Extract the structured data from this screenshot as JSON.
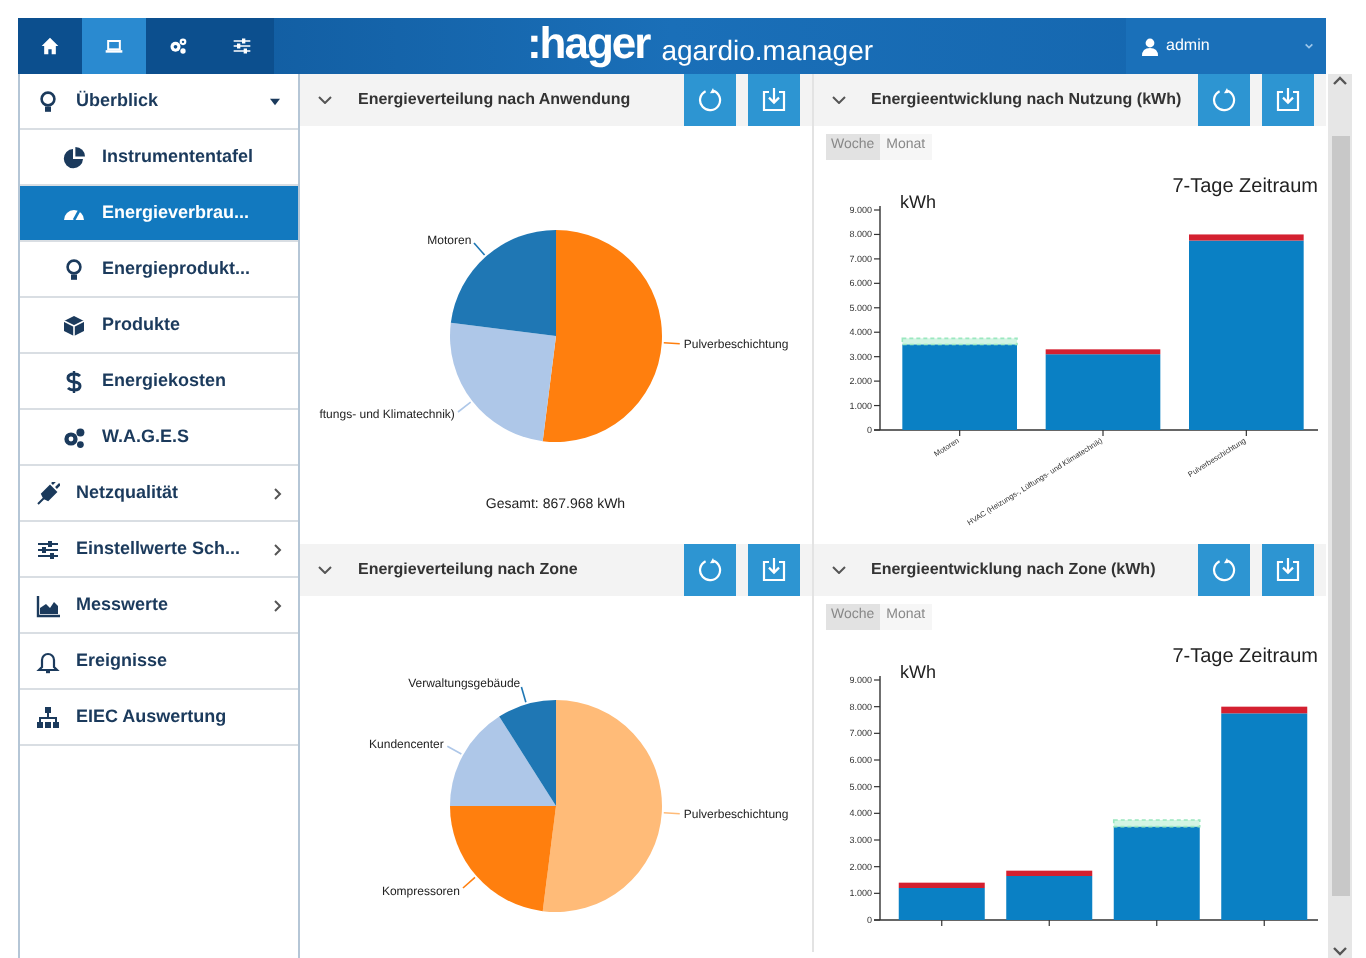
{
  "topbar": {
    "tabs": [
      {
        "selected": false
      },
      {
        "selected": true
      },
      {
        "selected": false
      },
      {
        "selected": false
      }
    ],
    "logo": ":hager",
    "product": "agardio.manager",
    "user": "admin"
  },
  "sidebar": {
    "items": [
      {
        "label": "Überblick",
        "selected": false,
        "expanded": true,
        "children": [
          {
            "label": "Instrumententafel",
            "selected": false
          },
          {
            "label": "Energieverbrau...",
            "selected": true
          },
          {
            "label": "Energieprodukt...",
            "selected": false
          },
          {
            "label": "Produkte",
            "selected": false
          },
          {
            "label": "Energiekosten",
            "selected": false
          },
          {
            "label": "W.A.G.E.S",
            "selected": false
          }
        ]
      },
      {
        "label": "Netzqualität",
        "selected": false,
        "expanded": false
      },
      {
        "label": "Einstellwerte Sch...",
        "selected": false,
        "expanded": false
      },
      {
        "label": "Messwerte",
        "selected": false,
        "expanded": false
      },
      {
        "label": "Ereignisse",
        "selected": false
      },
      {
        "label": "EIEC Auswertung",
        "selected": false
      }
    ]
  },
  "panels": [
    {
      "title": "Energieverteilung nach Anwendung",
      "total": "Gesamt: 867.968 kWh",
      "chart_data": {
        "type": "pie",
        "categories": [
          "Pulverbeschichtung",
          "ftungs- und Klimatechnik)",
          "Motoren"
        ],
        "values": [
          52,
          25,
          23
        ],
        "colors": [
          "#ff7f0e",
          "#aec7e8",
          "#1f77b4"
        ]
      }
    },
    {
      "title": "Energieentwicklung nach Nutzung (kWh)",
      "toggles": [
        {
          "label": "Woche",
          "selected": true
        },
        {
          "label": "Monat",
          "selected": false
        }
      ],
      "chart_data": {
        "type": "bar",
        "title": "7-Tage Zeitraum",
        "ylabel": "kWh",
        "stacked": true,
        "categories": [
          "Motoren",
          "HVAC (Heizungs-, Lüftungs- und Klimatechnik)",
          "Pulverbeschichtung"
        ],
        "series": [
          {
            "color": "#0a80c4",
            "values": [
              3500,
              3100,
              7750
            ]
          },
          {
            "color": "#d42030",
            "values": [
              0,
              200,
              250
            ]
          },
          {
            "color": "#9be8c0",
            "values": [
              250,
              0,
              0
            ]
          }
        ],
        "ylim": [
          0,
          9000
        ],
        "yticks": [
          {
            "value": 0,
            "label": "0"
          },
          {
            "value": 1000,
            "label": "1.000"
          },
          {
            "value": 2000,
            "label": "2.000"
          },
          {
            "value": 3000,
            "label": "3.000"
          },
          {
            "value": 4000,
            "label": "4.000"
          },
          {
            "value": 5000,
            "label": "5.000"
          },
          {
            "value": 6000,
            "label": "6.000"
          },
          {
            "value": 7000,
            "label": "7.000"
          },
          {
            "value": 8000,
            "label": "8.000"
          },
          {
            "value": 9000,
            "label": "9.000"
          }
        ]
      }
    },
    {
      "title": "Energieverteilung nach Zone",
      "chart_data": {
        "type": "pie",
        "categories": [
          "Pulverbeschichtung",
          "Kompressoren",
          "Kundencenter",
          "Verwaltungsgebäude"
        ],
        "values": [
          52,
          23,
          16,
          9
        ],
        "colors": [
          "#ffbb78",
          "#ff7f0e",
          "#aec7e8",
          "#1f77b4"
        ]
      }
    },
    {
      "title": "Energieentwicklung nach Zone (kWh)",
      "toggles": [
        {
          "label": "Woche",
          "selected": true
        },
        {
          "label": "Monat",
          "selected": false
        }
      ],
      "chart_data": {
        "type": "bar",
        "title": "7-Tage Zeitraum",
        "ylabel": "kWh",
        "stacked": true,
        "series": [
          {
            "color": "#0a80c4",
            "values": [
              1200,
              1650,
              3500,
              7750
            ]
          },
          {
            "color": "#d42030",
            "values": [
              200,
              200,
              0,
              250
            ]
          },
          {
            "color": "#9be8c0",
            "values": [
              0,
              0,
              250,
              0
            ]
          }
        ],
        "ylim": [
          0,
          9000
        ],
        "yticks": [
          {
            "value": 0,
            "label": "0"
          },
          {
            "value": 1000,
            "label": "1.000"
          },
          {
            "value": 2000,
            "label": "2.000"
          },
          {
            "value": 3000,
            "label": "3.000"
          },
          {
            "value": 4000,
            "label": "4.000"
          },
          {
            "value": 5000,
            "label": "5.000"
          },
          {
            "value": 6000,
            "label": "6.000"
          },
          {
            "value": 7000,
            "label": "7.000"
          },
          {
            "value": 8000,
            "label": "8.000"
          },
          {
            "value": 9000,
            "label": "9.000"
          }
        ]
      }
    }
  ]
}
